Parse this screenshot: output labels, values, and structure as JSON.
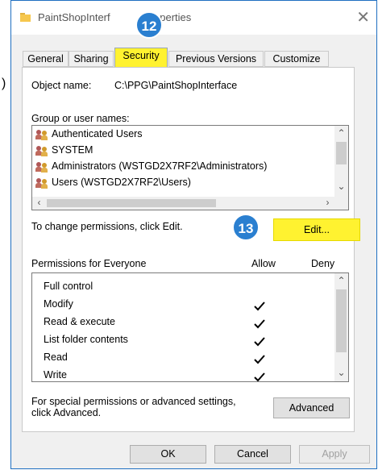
{
  "window": {
    "title": "PaintShopInterf",
    "title_end": "operties",
    "close": "✕"
  },
  "left_edge_fragment": ")",
  "badges": {
    "step12": "12",
    "step13": "13"
  },
  "tabs": [
    {
      "label": "General",
      "active": false
    },
    {
      "label": "Sharing",
      "active": false
    },
    {
      "label": "Security",
      "active": true
    },
    {
      "label": "Previous Versions",
      "active": false
    },
    {
      "label": "Customize",
      "active": false
    }
  ],
  "security": {
    "object_name_label": "Object name:",
    "object_name_value": "C:\\PPG\\PaintShopInterface",
    "groups_label": "Group or user names:",
    "groups": [
      "Authenticated Users",
      "SYSTEM",
      "Administrators (WSTGD2X7RF2\\Administrators)",
      "Users (WSTGD2X7RF2\\Users)"
    ],
    "change_text": "To change permissions, click Edit.",
    "edit_button": "Edit...",
    "permissions_for": "Permissions for Everyone",
    "allow_header": "Allow",
    "deny_header": "Deny",
    "permissions": [
      {
        "name": "Full control",
        "allow": false
      },
      {
        "name": "Modify",
        "allow": true
      },
      {
        "name": "Read & execute",
        "allow": true
      },
      {
        "name": "List folder contents",
        "allow": true
      },
      {
        "name": "Read",
        "allow": true
      },
      {
        "name": "Write",
        "allow": true
      }
    ],
    "special_text_1": "For special permissions or advanced settings,",
    "special_text_2": "click Advanced.",
    "advanced_button": "Advanced"
  },
  "buttons": {
    "ok": "OK",
    "cancel": "Cancel",
    "apply": "Apply"
  },
  "colors": {
    "highlight": "#fff230",
    "badge": "#2a7fd0",
    "window_border": "#1f6fc1"
  },
  "icons": [
    "folder-icon",
    "user-group-icon",
    "checkmark-icon",
    "close-icon"
  ]
}
